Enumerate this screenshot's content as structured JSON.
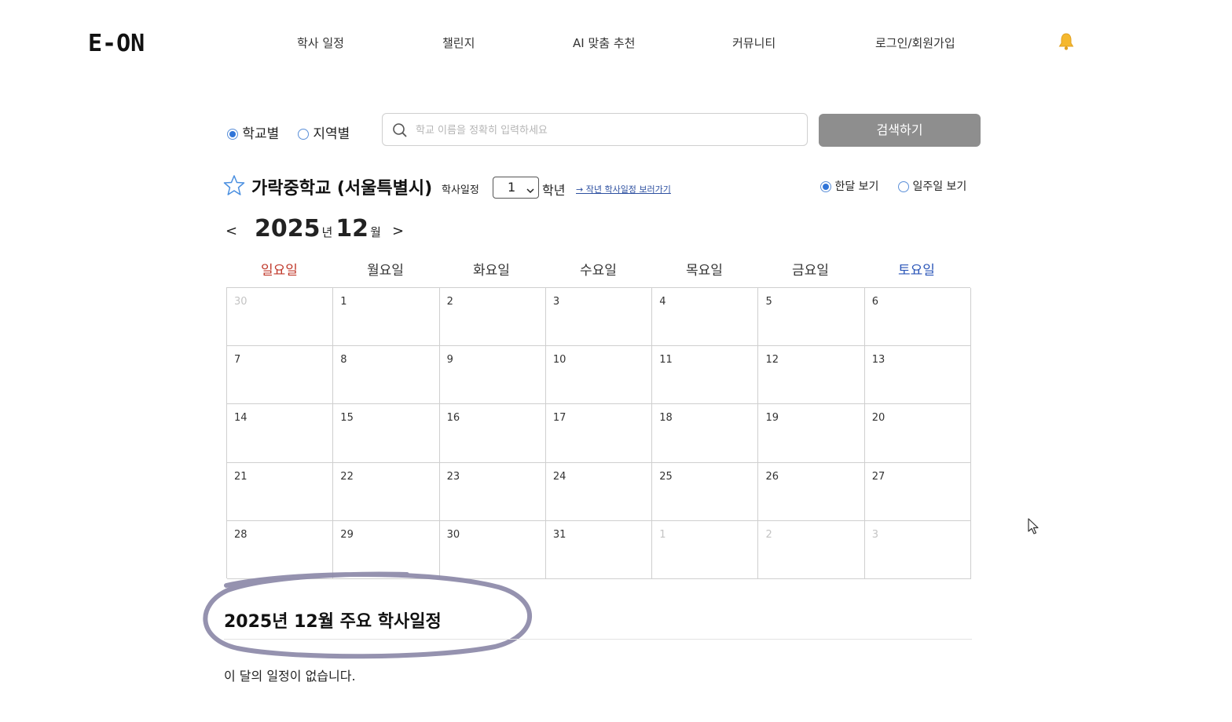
{
  "header": {
    "logo": "E-ON",
    "nav": [
      "학사 일정",
      "챌린지",
      "AI 맞춤 추천",
      "커뮤니티",
      "로그인/회원가입"
    ],
    "bell_icon": "bell-icon",
    "accent_color": "#f5b82e"
  },
  "search": {
    "mode_school": "학교별",
    "mode_region": "지역별",
    "selected_mode": "학교별",
    "placeholder": "학교 이름을 정확히 입력하세요",
    "value": "",
    "button": "검색하기",
    "button_color": "#8e8e8e"
  },
  "school": {
    "name": "가락중학교 (서울특별시)",
    "schedule_label": "학사일정",
    "grade_value": "1",
    "grade_unit": "학년",
    "prev_year_link": "→ 작년 학사일정 보러가기",
    "view_month": "한달 보기",
    "view_week": "일주일 보기",
    "selected_view": "한달 보기"
  },
  "calendar": {
    "prev": "<",
    "next": ">",
    "year": "2025",
    "year_unit": "년",
    "month": "12",
    "month_unit": "월",
    "weekdays": [
      "일요일",
      "월요일",
      "화요일",
      "수요일",
      "목요일",
      "금요일",
      "토요일"
    ],
    "weeks": [
      [
        {
          "d": "30",
          "o": true
        },
        {
          "d": "1"
        },
        {
          "d": "2"
        },
        {
          "d": "3"
        },
        {
          "d": "4"
        },
        {
          "d": "5"
        },
        {
          "d": "6"
        }
      ],
      [
        {
          "d": "7"
        },
        {
          "d": "8"
        },
        {
          "d": "9"
        },
        {
          "d": "10"
        },
        {
          "d": "11"
        },
        {
          "d": "12"
        },
        {
          "d": "13"
        }
      ],
      [
        {
          "d": "14"
        },
        {
          "d": "15"
        },
        {
          "d": "16"
        },
        {
          "d": "17"
        },
        {
          "d": "18"
        },
        {
          "d": "19"
        },
        {
          "d": "20"
        }
      ],
      [
        {
          "d": "21"
        },
        {
          "d": "22"
        },
        {
          "d": "23"
        },
        {
          "d": "24"
        },
        {
          "d": "25"
        },
        {
          "d": "26"
        },
        {
          "d": "27"
        }
      ],
      [
        {
          "d": "28"
        },
        {
          "d": "29"
        },
        {
          "d": "30"
        },
        {
          "d": "31"
        },
        {
          "d": "1",
          "o": true
        },
        {
          "d": "2",
          "o": true
        },
        {
          "d": "3",
          "o": true
        }
      ]
    ],
    "sunday_color": "#c0392b",
    "saturday_color": "#2b56b8"
  },
  "summary": {
    "title": "2025년 12월 주요 학사일정",
    "empty_message": "이 달의 일정이 없습니다.",
    "highlight_color": "#8a86a6"
  }
}
